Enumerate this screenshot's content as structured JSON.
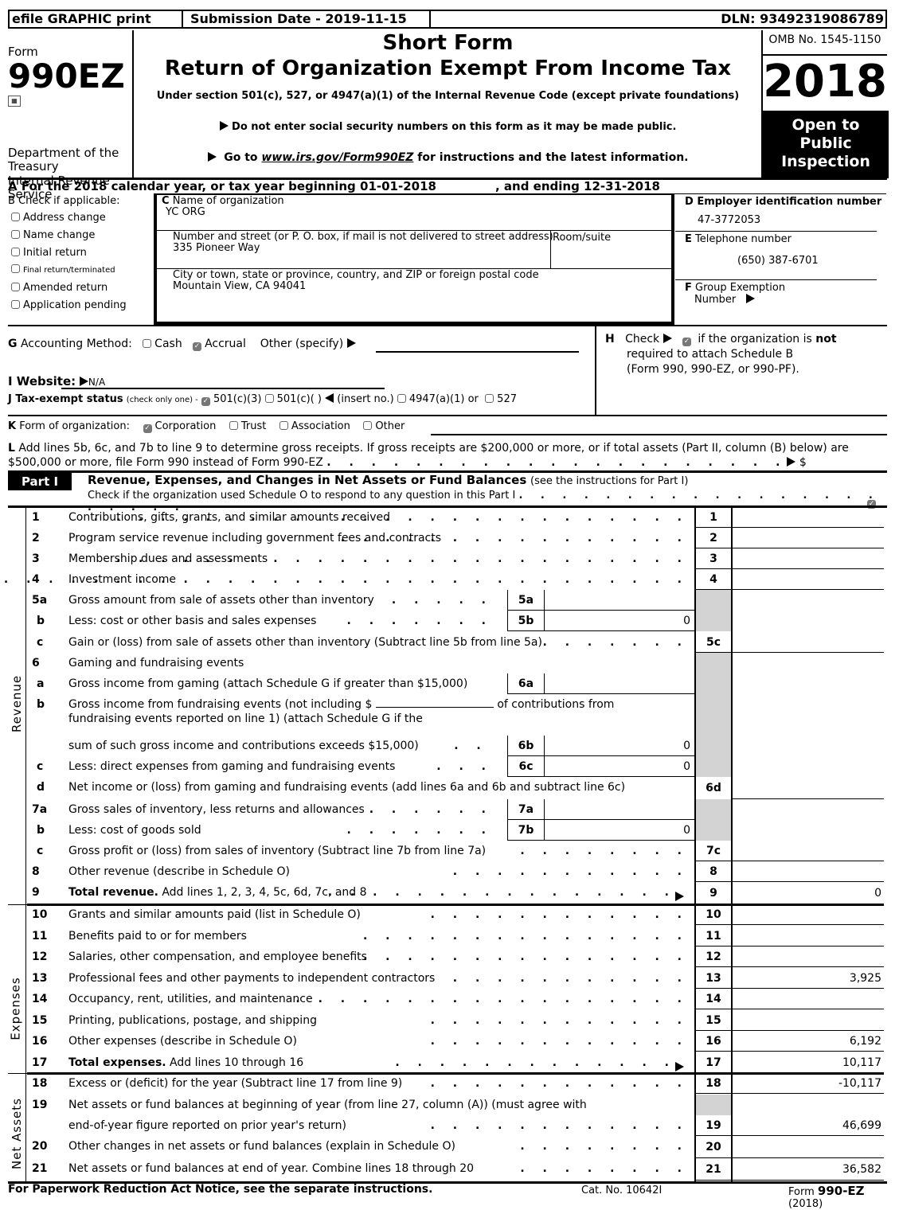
{
  "topbar": {
    "efile": "efile GRAPHIC print",
    "submission": "Submission Date - 2019-11-15",
    "dln": "DLN: 93492319086789"
  },
  "header": {
    "form_word": "Form",
    "form_number": "990EZ",
    "dept1": "Department of the",
    "dept2": "Treasury",
    "dept3": "Internal Revenue",
    "dept4": "Service",
    "title1": "Short Form",
    "title2": "Return of Organization Exempt From Income Tax",
    "subtitle": "Under section 501(c), 527, or 4947(a)(1) of the Internal Revenue Code (except private foundations)",
    "notice1": "Do not enter social security numbers on this form as it may be made public.",
    "notice2_pre": "Go to ",
    "notice2_link": "www.irs.gov/Form990EZ",
    "notice2_post": " for instructions and the latest information.",
    "omb": "OMB No. 1545-1150",
    "year": "2018",
    "open1": "Open to",
    "open2": "Public",
    "open3": "Inspection"
  },
  "lineA": {
    "text": "A  For the 2018 calendar year, or tax year beginning 01-01-2018",
    "ending": ", and ending 12-31-2018"
  },
  "sectionB": {
    "title": "B  Check if applicable:",
    "items": [
      "Address change",
      "Name change",
      "Initial return",
      "Final return/terminated",
      "Amended return",
      "Application pending"
    ]
  },
  "sectionC": {
    "name_label": "Name of organization",
    "name_value": "YC ORG",
    "street_label": "Number and street (or P. O. box, if mail is not delivered to street address)",
    "street_value": "335 Pioneer Way",
    "room_label": "Room/suite",
    "city_label": " City or town, state or province, country, and ZIP or foreign postal code",
    "city_value": "Mountain View, CA  94041"
  },
  "sectionD": {
    "label": "D Employer identification number",
    "value": "47-3772053"
  },
  "sectionE": {
    "label": "Telephone number",
    "value": "(650) 387-6701"
  },
  "sectionF": {
    "label1": "Group Exemption",
    "label2": "Number"
  },
  "sectionG": {
    "label": "Accounting Method:",
    "cash": "Cash",
    "accrual": "Accrual",
    "other": "Other (specify)",
    "selected": "Accrual"
  },
  "sectionH": {
    "check": "Check",
    "text1": "if the organization is ",
    "text_bold": "not",
    "text2": "required to attach Schedule B",
    "text3": "(Form 990, 990-EZ, or 990-PF).",
    "checked": true
  },
  "sectionI": {
    "label": "I Website:",
    "value": "N/A"
  },
  "sectionJ": {
    "label": "J Tax-exempt status",
    "note": "(check only one) -",
    "opt1": "501(c)(3)",
    "opt2": "501(c)(   )",
    "insert": "(insert no.)",
    "opt3": "4947(a)(1) or",
    "opt4": "527",
    "selected": "501(c)(3)"
  },
  "sectionK": {
    "label": "Form of organization:",
    "opts": [
      "Corporation",
      "Trust",
      "Association",
      "Other"
    ],
    "selected": "Corporation"
  },
  "sectionL": {
    "line1": "Add lines 5b, 6c, and 7b to line 9 to determine gross receipts. If gross receipts are $200,000 or more, or if total assets (Part II, column (B) below) are",
    "line2": "$500,000 or more, file Form 990 instead of Form 990-EZ",
    "dollar": "$"
  },
  "part1": {
    "badge": "Part I",
    "title": "Revenue, Expenses, and Changes in Net Assets or Fund Balances",
    "title_note": "(see the instructions for Part I)",
    "check_text": "Check if the organization used Schedule O to respond to any question in this Part I",
    "checked": true
  },
  "side_labels": {
    "revenue": "Revenue",
    "expenses": "Expenses",
    "net_assets": "Net Assets"
  },
  "lines": {
    "l1": {
      "num": "1",
      "text": "Contributions, gifts, grants, and similar amounts received",
      "box": "1",
      "value": ""
    },
    "l2": {
      "num": "2",
      "text": "Program service revenue including government fees and contracts",
      "box": "2",
      "value": ""
    },
    "l3": {
      "num": "3",
      "text": "Membership dues and assessments",
      "box": "3",
      "value": ""
    },
    "l4": {
      "num": "4",
      "text": "Investment income",
      "box": "4",
      "value": ""
    },
    "l5a": {
      "num": "5a",
      "text": "Gross amount from sale of assets other than inventory",
      "box": "5a",
      "value": ""
    },
    "l5b": {
      "num": "b",
      "text": "Less: cost or other basis and sales expenses",
      "box": "5b",
      "value": "0"
    },
    "l5c": {
      "num": "c",
      "text": "Gain or (loss) from sale of assets other than inventory (Subtract line 5b from line 5a)",
      "box": "5c",
      "value": ""
    },
    "l6": {
      "num": "6",
      "text": "Gaming and fundraising events"
    },
    "l6a": {
      "num": "a",
      "text": "Gross income from gaming (attach Schedule G if greater than $15,000)",
      "box": "6a",
      "value": ""
    },
    "l6b": {
      "num": "b",
      "text1": "Gross income from fundraising events (not including $",
      "text1b": "of contributions from",
      "text2": "fundraising events reported on line 1) (attach Schedule G if the",
      "text3": "sum of such gross income and contributions exceeds $15,000)",
      "box": "6b",
      "value": "0"
    },
    "l6c": {
      "num": "c",
      "text": "Less: direct expenses from gaming and fundraising events",
      "box": "6c",
      "value": "0"
    },
    "l6d": {
      "num": "d",
      "text": "Net income or (loss) from gaming and fundraising events (add lines 6a and 6b and subtract line 6c)",
      "box": "6d",
      "value": ""
    },
    "l7a": {
      "num": "7a",
      "text": "Gross sales of inventory, less returns and allowances",
      "box": "7a",
      "value": ""
    },
    "l7b": {
      "num": "b",
      "text": "Less: cost of goods sold",
      "box": "7b",
      "value": "0"
    },
    "l7c": {
      "num": "c",
      "text": "Gross profit or (loss) from sales of inventory (Subtract line 7b from line 7a)",
      "box": "7c",
      "value": ""
    },
    "l8": {
      "num": "8",
      "text": "Other revenue (describe in Schedule O)",
      "box": "8",
      "value": ""
    },
    "l9": {
      "num": "9",
      "text_bold": "Total revenue.",
      "text": " Add lines 1, 2, 3, 4, 5c, 6d, 7c, and 8",
      "box": "9",
      "value": "0"
    },
    "l10": {
      "num": "10",
      "text": "Grants and similar amounts paid (list in Schedule O)",
      "box": "10",
      "value": ""
    },
    "l11": {
      "num": "11",
      "text": "Benefits paid to or for members",
      "box": "11",
      "value": ""
    },
    "l12": {
      "num": "12",
      "text": "Salaries, other compensation, and employee benefits",
      "box": "12",
      "value": ""
    },
    "l13": {
      "num": "13",
      "text": "Professional fees and other payments to independent contractors",
      "box": "13",
      "value": "3,925"
    },
    "l14": {
      "num": "14",
      "text": "Occupancy, rent, utilities, and maintenance",
      "box": "14",
      "value": ""
    },
    "l15": {
      "num": "15",
      "text": "Printing, publications, postage, and shipping",
      "box": "15",
      "value": ""
    },
    "l16": {
      "num": "16",
      "text": "Other expenses (describe in Schedule O)",
      "box": "16",
      "value": "6,192"
    },
    "l17": {
      "num": "17",
      "text_bold": "Total expenses.",
      "text": " Add lines 10 through 16",
      "box": "17",
      "value": "10,117"
    },
    "l18": {
      "num": "18",
      "text": "Excess or (deficit) for the year (Subtract line 17 from line 9)",
      "box": "18",
      "value": "-10,117"
    },
    "l19": {
      "num": "19",
      "text1": "Net assets or fund balances at beginning of year (from line 27, column (A)) (must agree with",
      "text2": "end-of-year figure reported on prior year's return)",
      "box": "19",
      "value": "46,699"
    },
    "l20": {
      "num": "20",
      "text": "Other changes in net assets or fund balances (explain in Schedule O)",
      "box": "20",
      "value": ""
    },
    "l21": {
      "num": "21",
      "text": "Net assets or fund balances at end of year. Combine lines 18 through 20",
      "box": "21",
      "value": "36,582"
    }
  },
  "footer": {
    "notice": "For Paperwork Reduction Act Notice, see the separate instructions.",
    "cat": "Cat. No. 10642I",
    "form_pre": "Form ",
    "form_bold": "990-EZ",
    "form_post": " (2018)"
  }
}
